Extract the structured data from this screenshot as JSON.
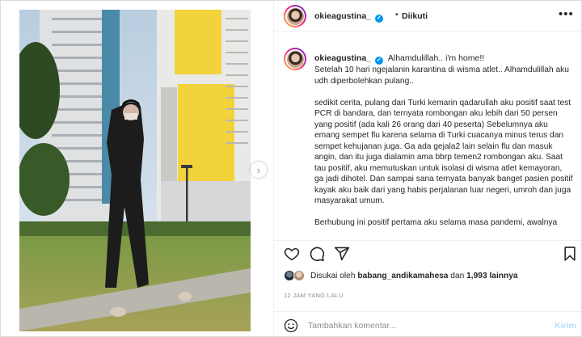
{
  "post": {
    "username": "okieagustina_",
    "verified_mark": "✓",
    "separator": "•",
    "follow_status": "Diikuti",
    "more_label": "•••",
    "next_arrow": "›",
    "caption": {
      "first_line": "Alhamdulillah.. i'm home!!",
      "body": "Setelah 10 hari ngejalanin karantina di wisma atlet.. Alhamdulillah aku udh diperbolehkan pulang..\n\nsedikit cerita, pulang dari Turki kemarin qadarullah aku positif saat test PCR di bandara, dan ternyata rombongan aku lebih dari 50 persen yang positif (ada kali 26 orang dari 40 peserta) Sebelumnya aku emang sempet flu karena selama di Turki cuacanya minus terus dan sempet kehujanan juga. Ga ada gejala2 lain selain flu dan masuk angin, dan itu juga dialamin ama bbrp temen2 rombongan aku. Saat tau positif, aku memutuskan untuk isolasi di wisma atlet kemayoran, ga jadi dihotel. Dan sampai sana ternyata banyak banget pasien positif kayak aku baik dari yang habis perjalanan luar negeri, umroh dan juga masyarakat umum.\n\nBerhubung ini positif pertama aku selama masa pandemi, awalnya"
    },
    "likes": {
      "prefix": "Disukai oleh",
      "first_liker": "babang_andikamahesa",
      "joiner": "dan",
      "others": "1,993 lainnya"
    },
    "time_ago": "12 JAM YANG LALU",
    "comment": {
      "placeholder": "Tambahkan komentar...",
      "post_label": "Kirim"
    }
  },
  "icons": {
    "like": "heart-icon",
    "comment": "comment-bubble-icon",
    "share": "paper-plane-icon",
    "save": "bookmark-icon",
    "emoji": "smiley-icon",
    "more": "more-dots-icon",
    "next": "chevron-right-icon"
  },
  "colors": {
    "verified_blue": "#0095f6",
    "post_button_disabled": "#b3dbff",
    "muted_text": "#8e8e8e",
    "building_yellow": "#f2d33c"
  }
}
